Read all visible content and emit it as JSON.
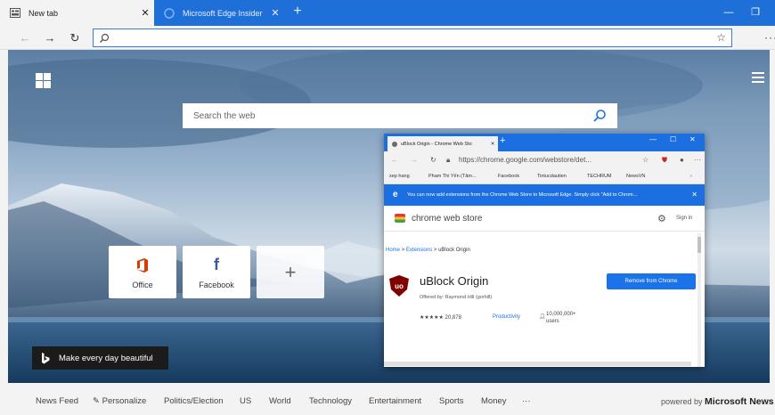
{
  "tabs": [
    {
      "title": "New tab",
      "active": true
    },
    {
      "title": "Microsoft Edge Insider",
      "active": false
    }
  ],
  "address": {
    "placeholder": ""
  },
  "search": {
    "placeholder": "Search the web"
  },
  "tiles": [
    {
      "label": "Office",
      "icon": "office-icon"
    },
    {
      "label": "Facebook",
      "icon": "facebook-icon"
    },
    {
      "label": "",
      "icon": "plus-icon"
    }
  ],
  "bing": {
    "caption": "Make every day beautiful"
  },
  "inset": {
    "tab_title": "uBlock Origin - Chrome Web Sto",
    "url": "https://chrome.google.com/webstore/det...",
    "bookmarks": [
      "xep hang",
      "Pham Thi Yến (Tâm...",
      "Facebook",
      "Tintucdautien",
      "TECHRUM",
      "NewsVN"
    ],
    "info_banner": "You can now add extensions from the Chrome Web Store to Microsoft Edge. Simply click \"Add to Chrom...",
    "store_name": "chrome web store",
    "signin": "Sign in",
    "breadcrumb": {
      "home": "Home",
      "sep1": ">",
      "ext": "Extensions",
      "sep2": ">",
      "item": "uBlock Origin"
    },
    "ext_name": "uBlock Origin",
    "offered_by": "Offered by: Raymond Hill (gorhill)",
    "rating_count": "★★★★★ 20,878",
    "category": "Productivity",
    "users_count": "10,000,000+",
    "users_label": "users",
    "remove_label": "Remove from Chrome"
  },
  "news": {
    "items": [
      "News Feed",
      "Personalize",
      "Politics/Election",
      "US",
      "World",
      "Technology",
      "Entertainment",
      "Sports",
      "Money",
      "···"
    ],
    "powered_prefix": "powered by",
    "powered_brand": "Microsoft News"
  },
  "colors": {
    "tabbar": "#1f6fd8",
    "accent": "#1a73e8",
    "office": "#d83b01",
    "facebook": "#3b5998"
  }
}
